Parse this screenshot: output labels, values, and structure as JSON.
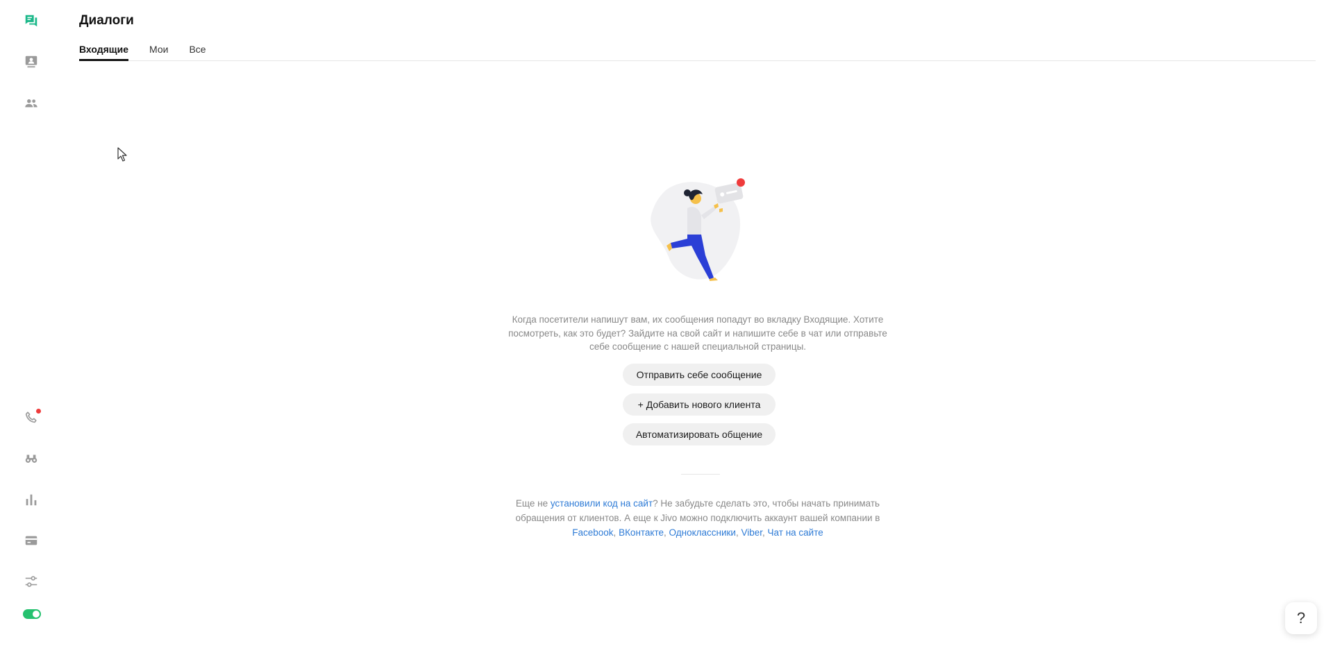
{
  "colors": {
    "accent": "#1cb88a",
    "toggle": "#25c16f",
    "link": "#2e7bd6",
    "badge": "#ef3b3b",
    "icon_muted": "#9a9a9a"
  },
  "sidebar": {
    "top_items": [
      {
        "icon": "chat-bubbles-icon",
        "active": true
      },
      {
        "icon": "contact-card-icon",
        "active": false
      },
      {
        "icon": "team-icon",
        "active": false
      }
    ],
    "bottom_items": [
      {
        "icon": "phone-icon",
        "has_badge": true
      },
      {
        "icon": "binoculars-icon"
      },
      {
        "icon": "bar-chart-icon"
      },
      {
        "icon": "credit-card-icon"
      },
      {
        "icon": "settings-sliders-icon"
      }
    ],
    "status_toggle_on": true
  },
  "header": {
    "title": "Диалоги",
    "tabs": [
      {
        "label": "Входящие",
        "active": true
      },
      {
        "label": "Мои",
        "active": false
      },
      {
        "label": "Все",
        "active": false
      }
    ]
  },
  "empty_state": {
    "description": "Когда посетители напишут вам, их сообщения попадут во вкладку Входящие. Хотите посмотреть, как это будет? Зайдите на свой сайт и напишите себе в чат или отправьте себе сообщение с нашей специальной страницы.",
    "buttons": {
      "send_self": "Отправить себе сообщение",
      "add_client": "+ Добавить нового клиента",
      "automate": "Автоматизировать общение"
    },
    "bottom": {
      "prefix": "Еще не ",
      "install_link": "установили код на сайт",
      "middle": "? Не забудьте сделать это, чтобы начать принимать обращения от клиентов. А еще к Jivo можно подключить аккаунт вашей компании в ",
      "channels": [
        "Facebook",
        "ВКонтакте",
        "Одноклассники",
        "Viber",
        "Чат на сайте"
      ]
    }
  },
  "help": {
    "label": "?"
  }
}
